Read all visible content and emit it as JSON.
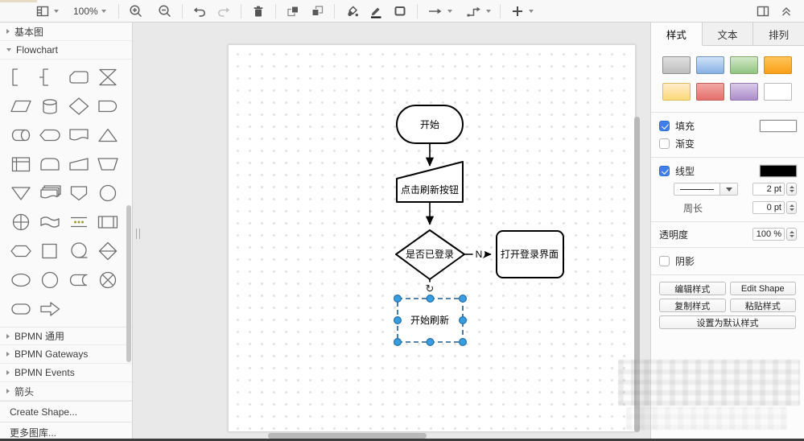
{
  "toolbar": {
    "zoom_level": "100%"
  },
  "sidebar": {
    "sections": [
      {
        "label": "基本图",
        "expanded": false
      },
      {
        "label": "Flowchart",
        "expanded": true
      }
    ],
    "shapes": [
      "loop-limit",
      "annotation",
      "card",
      "collate",
      "data",
      "database",
      "decision",
      "delay",
      "direct-access-storage",
      "display",
      "document",
      "extract",
      "internal-storage",
      "stored-data-arc",
      "manual-input",
      "manual-operation",
      "merge",
      "multi-document",
      "off-page-connector",
      "connector",
      "or",
      "paper-tape",
      "parallel-mode",
      "predefined-process",
      "preparation",
      "process",
      "sequential-data",
      "sort",
      "ellipse",
      "circle",
      "stored-data",
      "summing-junction",
      "terminator",
      "arrow"
    ],
    "bottom_sections": [
      "BPMN 通用",
      "BPMN Gateways",
      "BPMN Events",
      "箭头"
    ],
    "footer_items": [
      "Create Shape...",
      "更多图库..."
    ]
  },
  "canvas": {
    "nodes": {
      "start": "开始",
      "click_refresh": "点击刷新按钮",
      "logged_in": "是否已登录",
      "open_login": "打开登录界面",
      "start_refresh": "开始刷新"
    },
    "edge_labels": {
      "no": "N"
    }
  },
  "panel": {
    "tabs": [
      {
        "label": "样式",
        "active": true
      },
      {
        "label": "文本",
        "active": false
      },
      {
        "label": "排列",
        "active": false
      }
    ],
    "swatches": [
      {
        "name": "gray",
        "top": "#e0e0e0",
        "bottom": "#bdbdbd",
        "border": "#8f8f8f"
      },
      {
        "name": "blue",
        "top": "#cfe3f9",
        "bottom": "#86b0e2",
        "border": "#7293b8"
      },
      {
        "name": "green",
        "top": "#d3e8c9",
        "bottom": "#90c481",
        "border": "#7fa569"
      },
      {
        "name": "orange",
        "top": "#ffc458",
        "bottom": "#f9a018",
        "border": "#d98e0c"
      },
      {
        "name": "yellow",
        "top": "#ffeccb",
        "bottom": "#fcd978",
        "border": "#d8bc66"
      },
      {
        "name": "red",
        "top": "#f2a8a4",
        "bottom": "#e4706b",
        "border": "#c25e59"
      },
      {
        "name": "purple",
        "top": "#d9cbe8",
        "bottom": "#ab8cc9",
        "border": "#9379ad"
      },
      {
        "name": "white",
        "top": "#ffffff",
        "bottom": "#ffffff",
        "border": "#b9b9b9"
      }
    ],
    "fill": {
      "label": "填充",
      "checked": true,
      "color": "#ffffff"
    },
    "gradient": {
      "label": "渐变",
      "checked": false
    },
    "line": {
      "label": "线型",
      "checked": true,
      "color": "#000000",
      "width": "2 pt"
    },
    "perimeter": {
      "label": "周长",
      "value": "0 pt"
    },
    "opacity": {
      "label": "透明度",
      "value": "100 %"
    },
    "shadow": {
      "label": "阴影",
      "checked": false
    },
    "buttons": [
      "编辑样式",
      "Edit Shape",
      "复制样式",
      "粘贴样式",
      "设置为默认样式"
    ]
  }
}
